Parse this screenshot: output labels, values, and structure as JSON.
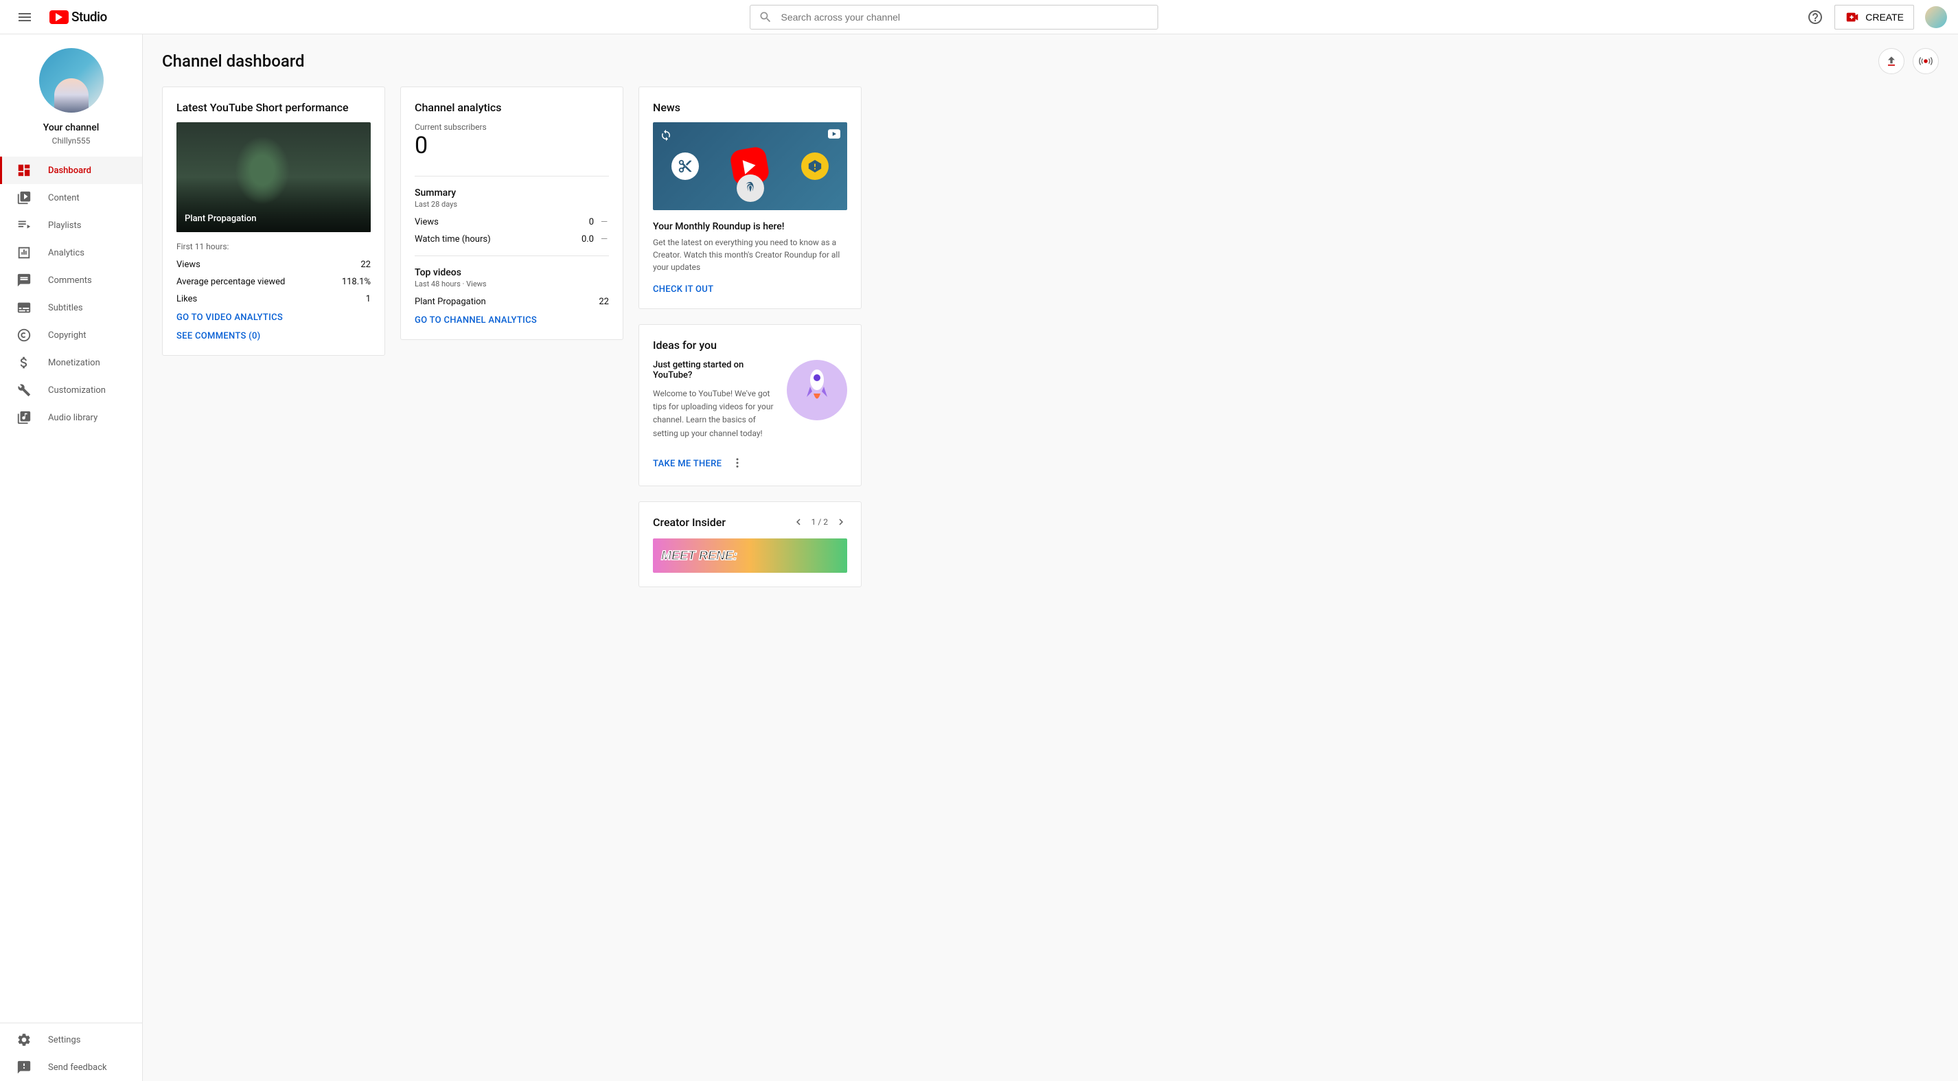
{
  "header": {
    "logo_text": "Studio",
    "search_placeholder": "Search across your channel",
    "create_label": "CREATE"
  },
  "channel": {
    "label": "Your channel",
    "name": "Chillyn555"
  },
  "nav": {
    "dashboard": "Dashboard",
    "content": "Content",
    "playlists": "Playlists",
    "analytics": "Analytics",
    "comments": "Comments",
    "subtitles": "Subtitles",
    "copyright": "Copyright",
    "monetization": "Monetization",
    "customization": "Customization",
    "audio": "Audio library",
    "settings": "Settings",
    "feedback": "Send feedback"
  },
  "page": {
    "title": "Channel dashboard"
  },
  "latest": {
    "title": "Latest YouTube Short performance",
    "video_title": "Plant Propagation",
    "first_hours": "First 11 hours:",
    "views_label": "Views",
    "views_value": "22",
    "avg_label": "Average percentage viewed",
    "avg_value": "118.1%",
    "likes_label": "Likes",
    "likes_value": "1",
    "link_analytics": "GO TO VIDEO ANALYTICS",
    "link_comments": "SEE COMMENTS (0)"
  },
  "analytics": {
    "title": "Channel analytics",
    "subs_label": "Current subscribers",
    "subs_value": "0",
    "summary_title": "Summary",
    "summary_sub": "Last 28 days",
    "views_label": "Views",
    "views_value": "0",
    "watch_label": "Watch time (hours)",
    "watch_value": "0.0",
    "top_title": "Top videos",
    "top_sub": "Last 48 hours · Views",
    "top_video": "Plant Propagation",
    "top_views": "22",
    "link": "GO TO CHANNEL ANALYTICS"
  },
  "news": {
    "title": "News",
    "headline": "Your Monthly Roundup is here!",
    "body": "Get the latest on everything you need to know as a Creator. Watch this month's Creator Roundup for all your updates",
    "link": "CHECK IT OUT"
  },
  "ideas": {
    "title": "Ideas for you",
    "subtitle": "Just getting started on YouTube?",
    "body": "Welcome to YouTube! We've got tips for uploading videos for your channel. Learn the basics of setting up your channel today!",
    "link": "TAKE ME THERE"
  },
  "insider": {
    "title": "Creator Insider",
    "page": "1 / 2",
    "thumb_text": "MEET RENE:"
  }
}
